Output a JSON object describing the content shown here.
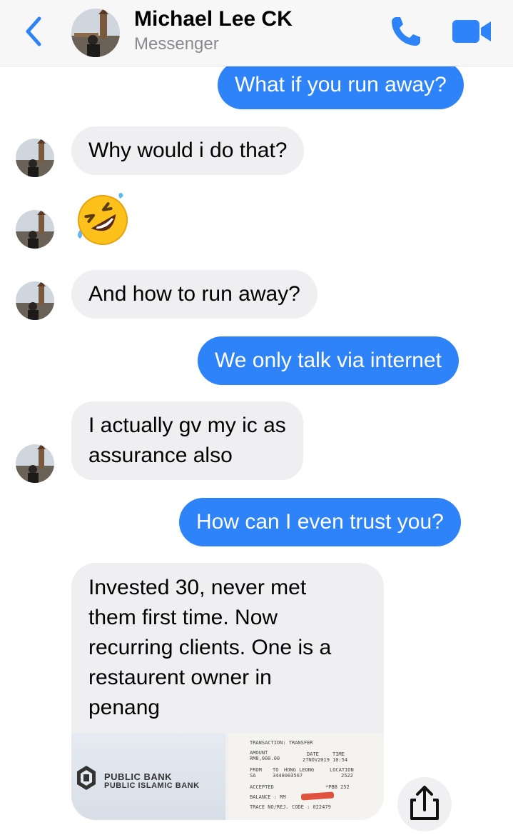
{
  "header": {
    "name": "Michael Lee CK",
    "subtitle": "Messenger"
  },
  "icons": {
    "back": "chevron-left-icon",
    "call": "phone-icon",
    "video": "video-camera-icon",
    "share": "share-icon",
    "emoji": "rolling-on-the-floor-laughing-emoji"
  },
  "colors": {
    "outgoing_bubble": "#2d83f7",
    "incoming_bubble": "#efeff1",
    "accent": "#2d83f7"
  },
  "messages": [
    {
      "dir": "out",
      "text": "What if you run away?"
    },
    {
      "dir": "in",
      "text": "Why would i do that?"
    },
    {
      "dir": "in",
      "text": "🤣",
      "type": "emoji"
    },
    {
      "dir": "in",
      "text": "And how to run away?"
    },
    {
      "dir": "out",
      "text": "We only talk via internet"
    },
    {
      "dir": "in",
      "text": "I actually gv my ic as\nassurance also"
    },
    {
      "dir": "out",
      "text": "How can I even trust you?"
    },
    {
      "dir": "in",
      "text": "Invested 30, never met\nthem first time. Now\nrecurring clients. One is a\nrestaurent owner in\npenang"
    }
  ],
  "attachments": {
    "bank_sign": {
      "line1": "PUBLIC BANK",
      "line2": "PUBLIC ISLAMIC BANK"
    },
    "receipt": {
      "transaction": "TRANSACTION: TRANSFER",
      "amount_label": "AMOUNT",
      "amount": "RM8,000.00",
      "date_label": "DATE",
      "date": "27NOV2019",
      "time_label": "TIME",
      "time": "10:54",
      "from_label": "FROM",
      "from": "SA",
      "to_label": "TO",
      "to": "HONG LEONG",
      "to_account": "3440003567",
      "location_label": "LOCATION",
      "location": "2522",
      "status": "ACCEPTED",
      "pbb": "*PBB 252",
      "balance_label": "BALANCE : RM",
      "trace": "TRACE NO/REJ. CODE :  022479"
    }
  }
}
